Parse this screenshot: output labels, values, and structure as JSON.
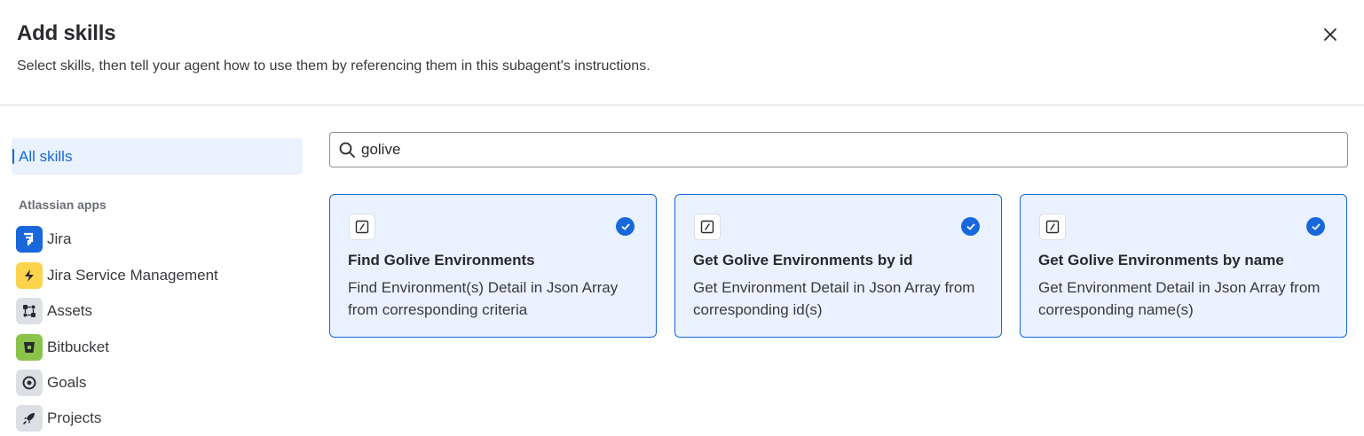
{
  "header": {
    "title": "Add skills",
    "subtitle": "Select skills, then tell your agent how to use them by referencing them in this subagent's instructions."
  },
  "sidebar": {
    "all_label": "All skills",
    "section_title": "Atlassian apps",
    "apps": [
      {
        "label": "Jira",
        "icon": "jira-icon"
      },
      {
        "label": "Jira Service Management",
        "icon": "jira-service-management-icon"
      },
      {
        "label": "Assets",
        "icon": "assets-icon"
      },
      {
        "label": "Bitbucket",
        "icon": "bitbucket-icon"
      },
      {
        "label": "Goals",
        "icon": "goals-icon"
      },
      {
        "label": "Projects",
        "icon": "projects-icon"
      }
    ]
  },
  "search": {
    "value": "golive"
  },
  "skills": [
    {
      "name": "Find Golive Environments",
      "description": "Find Environment(s) Detail in Json Array from corresponding criteria",
      "selected": true
    },
    {
      "name": "Get Golive Environments by id",
      "description": "Get Environment Detail in Json Array from corresponding id(s)",
      "selected": true
    },
    {
      "name": "Get Golive Environments by name",
      "description": "Get Environment Detail in Json Array from corresponding name(s)",
      "selected": true
    }
  ],
  "colors": {
    "accent": "#1868db",
    "selected_bg": "#e9f2fe",
    "jira": "#1868db",
    "jsm": "#fcd34d",
    "bitbucket": "#8bc34a",
    "neutral_icon_bg": "#dcdfe4"
  }
}
